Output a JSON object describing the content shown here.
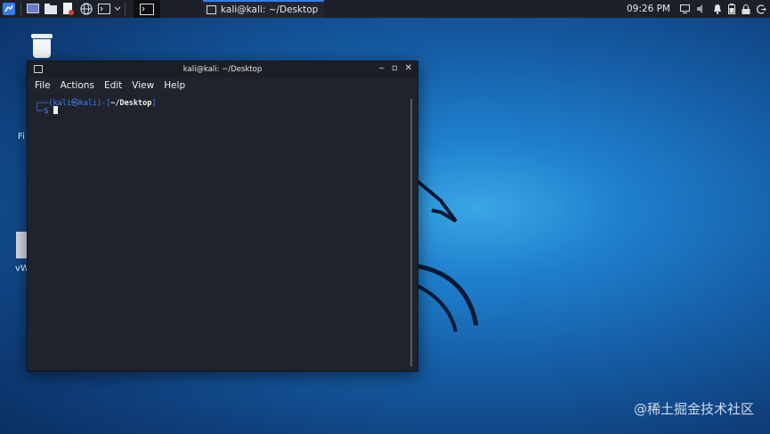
{
  "panel": {
    "active_window_title": "kali@kali: ~/Desktop",
    "clock": "09:26 PM"
  },
  "desktop": {
    "icon_labels": [
      "Fi",
      "vW"
    ]
  },
  "terminal": {
    "title": "kali@kali: ~/Desktop",
    "menu": [
      "File",
      "Actions",
      "Edit",
      "View",
      "Help"
    ],
    "prompt_top_prefix": "┌──(",
    "prompt_user": "kali㉿kali",
    "prompt_mid": ")-[",
    "prompt_path": "~/Desktop",
    "prompt_end": "]",
    "prompt_bottom_prefix": "└─",
    "prompt_symbol": "$"
  },
  "watermark": "@稀土掘金技术社区",
  "colors": {
    "panel_bg": "#1d2028",
    "accent": "#367bf0",
    "terminal_bg": "#20242c",
    "prompt_blue": "#3c7ff5"
  }
}
